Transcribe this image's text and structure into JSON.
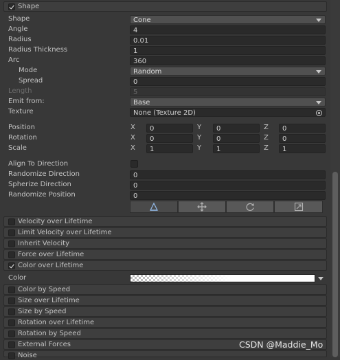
{
  "header": {
    "title": "Shape",
    "checked": true
  },
  "shape_props": {
    "shape": {
      "label": "Shape",
      "value": "Cone"
    },
    "angle": {
      "label": "Angle",
      "value": "4"
    },
    "radius": {
      "label": "Radius",
      "value": "0.01"
    },
    "radius_thickness": {
      "label": "Radius Thickness",
      "value": "1"
    },
    "arc": {
      "label": "Arc",
      "value": "360"
    },
    "mode": {
      "label": "Mode",
      "value": "Random"
    },
    "spread": {
      "label": "Spread",
      "value": "0"
    },
    "length": {
      "label": "Length",
      "value": "5"
    },
    "emit_from": {
      "label": "Emit from:",
      "value": "Base"
    },
    "texture": {
      "label": "Texture",
      "value": "None (Texture 2D)"
    }
  },
  "transform": {
    "axes": [
      "X",
      "Y",
      "Z"
    ],
    "position": {
      "label": "Position",
      "values": [
        "0",
        "0",
        "0"
      ]
    },
    "rotation": {
      "label": "Rotation",
      "values": [
        "0",
        "0",
        "0"
      ]
    },
    "scale": {
      "label": "Scale",
      "values": [
        "1",
        "1",
        "1"
      ]
    }
  },
  "direction": {
    "align_to_direction": {
      "label": "Align To Direction",
      "checked": false
    },
    "randomize_direction": {
      "label": "Randomize Direction",
      "value": "0"
    },
    "spherize_direction": {
      "label": "Spherize Direction",
      "value": "0"
    },
    "randomize_position": {
      "label": "Randomize Position",
      "value": "0"
    }
  },
  "tool_buttons": [
    "edit-shape-icon",
    "move-icon",
    "rotate-icon",
    "scale-icon"
  ],
  "modules_top": [
    {
      "label": "Velocity over Lifetime",
      "checked": false
    },
    {
      "label": "Limit Velocity over Lifetime",
      "checked": false
    },
    {
      "label": "Inherit Velocity",
      "checked": false
    },
    {
      "label": "Force over Lifetime",
      "checked": false
    },
    {
      "label": "Color over Lifetime",
      "checked": true
    }
  ],
  "color_row": {
    "label": "Color"
  },
  "modules_bottom": [
    {
      "label": "Color by Speed",
      "checked": false
    },
    {
      "label": "Size over Lifetime",
      "checked": false
    },
    {
      "label": "Size by Speed",
      "checked": false
    },
    {
      "label": "Rotation over Lifetime",
      "checked": false
    },
    {
      "label": "Rotation by Speed",
      "checked": false
    },
    {
      "label": "External Forces",
      "checked": false
    },
    {
      "label": "Noise",
      "checked": false
    }
  ],
  "watermark": "CSDN @Maddie_Mo",
  "colors": {
    "panel": "#383838",
    "field": "#2a2a2a",
    "module": "#3e3e3e"
  }
}
